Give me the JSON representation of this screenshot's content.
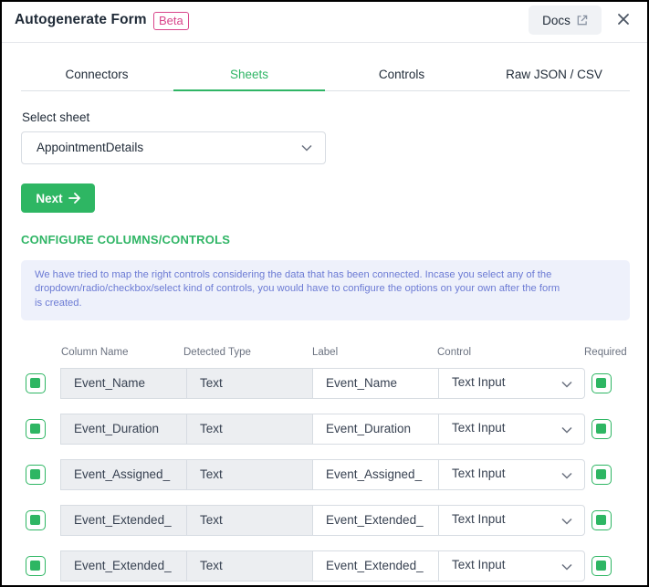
{
  "header": {
    "title": "Autogenerate Form",
    "badge": "Beta",
    "docs_label": "Docs"
  },
  "tabs": [
    {
      "label": "Connectors",
      "active": false
    },
    {
      "label": "Sheets",
      "active": true
    },
    {
      "label": "Controls",
      "active": false
    },
    {
      "label": "Raw JSON / CSV",
      "active": false
    }
  ],
  "sheet_select": {
    "label": "Select sheet",
    "value": "AppointmentDetails"
  },
  "next_button": {
    "label": "Next"
  },
  "configure": {
    "title": "CONFIGURE COLUMNS/CONTROLS",
    "info_line1": "We have tried to map the right controls considering the data that has been connected. Incase you select any of the",
    "info_line2": "dropdown/radio/checkbox/select kind of controls, you would have to configure the options on your own after the form",
    "info_line3": "is created."
  },
  "table": {
    "headers": {
      "column_name": "Column Name",
      "detected_type": "Detected Type",
      "label": "Label",
      "control": "Control",
      "required": "Required"
    },
    "rows": [
      {
        "column_name": "Event_Name",
        "detected_type": "Text",
        "label": "Event_Name",
        "control": "Text Input",
        "selected": true,
        "required": true
      },
      {
        "column_name": "Event_Duration",
        "detected_type": "Text",
        "label": "Event_Duration",
        "control": "Text Input",
        "selected": true,
        "required": true
      },
      {
        "column_name": "Event_Assigned_",
        "detected_type": "Text",
        "label": "Event_Assigned_",
        "control": "Text Input",
        "selected": true,
        "required": true
      },
      {
        "column_name": "Event_Extended_",
        "detected_type": "Text",
        "label": "Event_Extended_",
        "control": "Text Input",
        "selected": true,
        "required": true
      },
      {
        "column_name": "Event_Extended_",
        "detected_type": "Text",
        "label": "Event_Extended_",
        "control": "Text Input",
        "selected": true,
        "required": true
      }
    ]
  },
  "colors": {
    "accent": "#2eb663",
    "beta": "#d9458b",
    "info_text": "#6c7bd4",
    "info_bg": "#eef1fb"
  }
}
